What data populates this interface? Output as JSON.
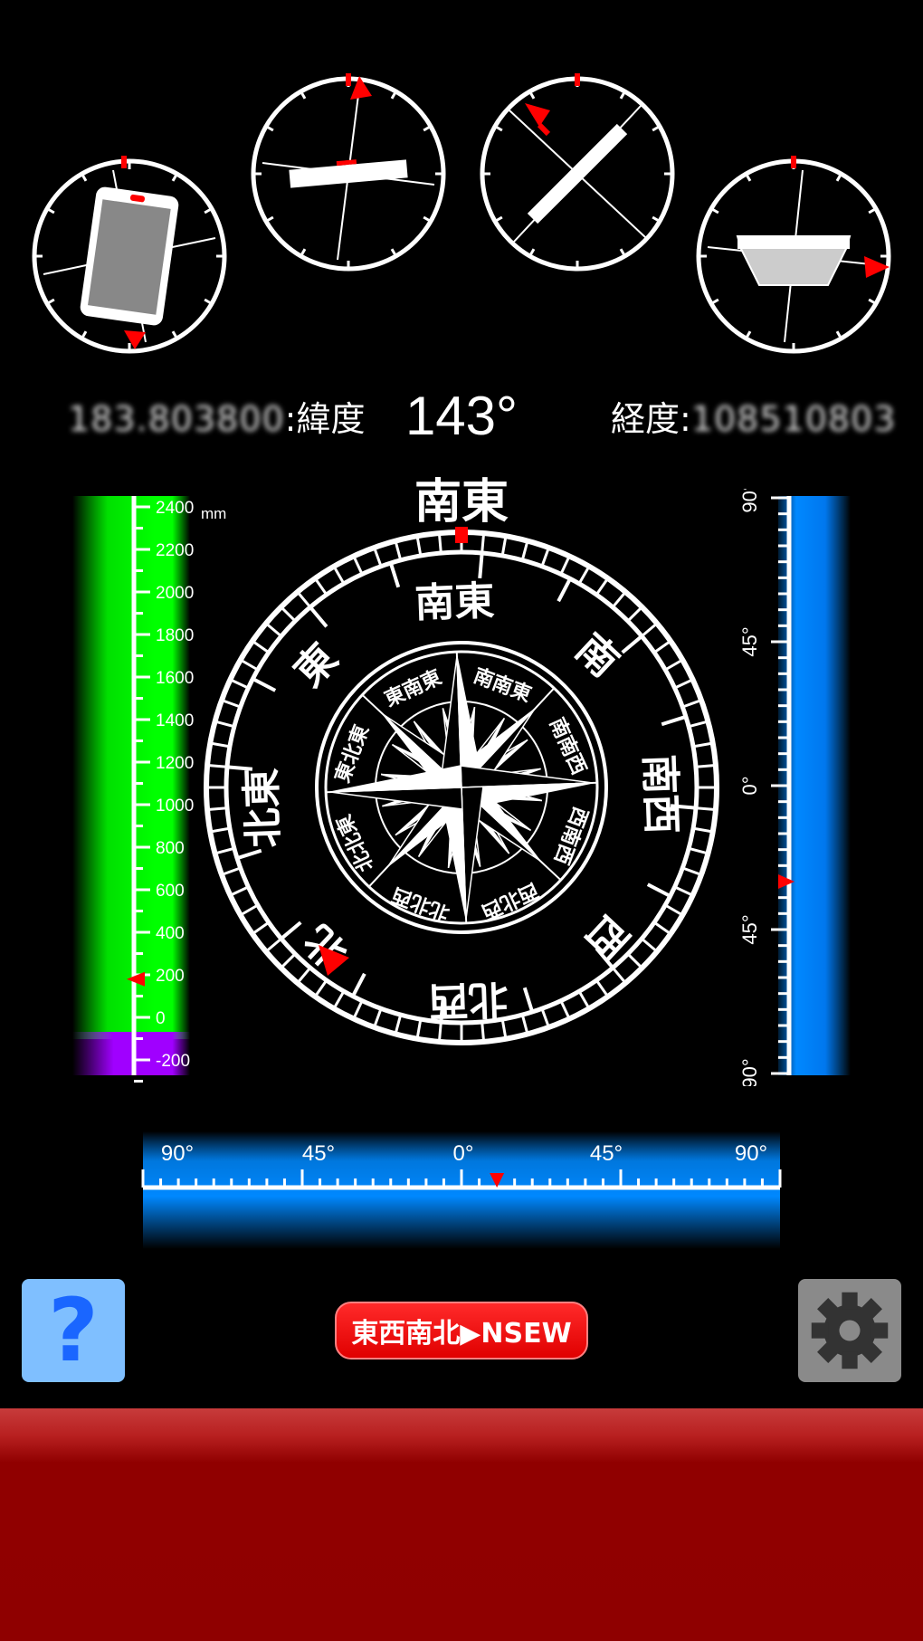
{
  "info": {
    "latitude_label": ":緯度",
    "latitude_value": "183.803800",
    "heading": "143°",
    "longitude_label": "経度:",
    "longitude_value": "108510803"
  },
  "compass": {
    "top_direction": "南東",
    "outer_labels": [
      "南東",
      "南",
      "南西",
      "西",
      "北西",
      "北",
      "北東",
      "東"
    ],
    "inner_labels": [
      "南南東",
      "南南西",
      "西南西",
      "西北西",
      "北北西",
      "北北東",
      "東北東",
      "東南東"
    ]
  },
  "altitude_scale": {
    "unit": "mm",
    "ticks": [
      "2400",
      "2200",
      "2000",
      "1800",
      "1600",
      "1400",
      "1200",
      "1000",
      "800",
      "600",
      "400",
      "200",
      "0",
      "-200"
    ],
    "current_value": 180
  },
  "vertical_tilt_scale": {
    "ticks": [
      "90°",
      "45°",
      "0°",
      "45°",
      "90°"
    ],
    "current_value": -30
  },
  "horizontal_tilt_scale": {
    "ticks": [
      "90°",
      "45°",
      "0°",
      "45°",
      "90°"
    ],
    "current_value": 10
  },
  "buttons": {
    "help_label": "?",
    "toggle_label": "東西南北▶NSEW"
  },
  "colors": {
    "marker": "#ff0000",
    "altitude_bar": "#00ff00",
    "below_zero_bar": "#a000ff",
    "tilt_bar": "#0088ff",
    "help_bg": "#7fbfff",
    "settings_bg": "#8a8a8a",
    "banner": "#8f0000"
  }
}
